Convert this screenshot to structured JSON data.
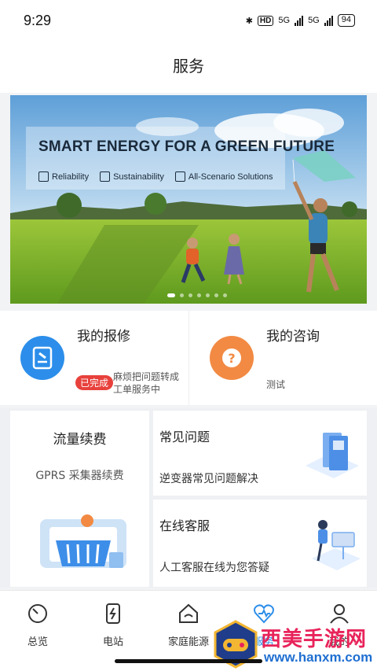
{
  "status_bar": {
    "time": "9:29",
    "hd": "HD",
    "net1": "5G",
    "net2": "5G",
    "battery": "94"
  },
  "header": {
    "title": "服务"
  },
  "banner": {
    "headline": "SMART ENERGY FOR A GREEN FUTURE",
    "tags": [
      "Reliability",
      "Sustainability",
      "All-Scenario Solutions"
    ],
    "page_count": 7,
    "active_page": 1
  },
  "repair": {
    "title": "我的报修",
    "badge": "已完成",
    "desc_line1": "麻烦把问题转成",
    "desc_line2": "工单服务中"
  },
  "consult": {
    "title": "我的咨询",
    "desc": "测试"
  },
  "traffic": {
    "title": "流量续费",
    "sub": "GPRS 采集器续费"
  },
  "faq": {
    "title": "常见问题",
    "sub": "逆变器常见问题解决"
  },
  "online": {
    "title": "在线客服",
    "sub": "人工客服在线为您答疑"
  },
  "tabbar": {
    "tabs": [
      {
        "label": "总览",
        "icon": "gauge-icon"
      },
      {
        "label": "电站",
        "icon": "power-station-icon"
      },
      {
        "label": "家庭能源",
        "icon": "home-energy-icon"
      },
      {
        "label": "服务",
        "icon": "service-heart-icon"
      },
      {
        "label": "我的",
        "icon": "user-icon"
      }
    ]
  },
  "watermark": {
    "text": "西美手游网",
    "url": "www.hanxm.com"
  },
  "colors": {
    "accent": "#2c8eea",
    "badge_red": "#e8413c",
    "orange": "#f28a43"
  }
}
